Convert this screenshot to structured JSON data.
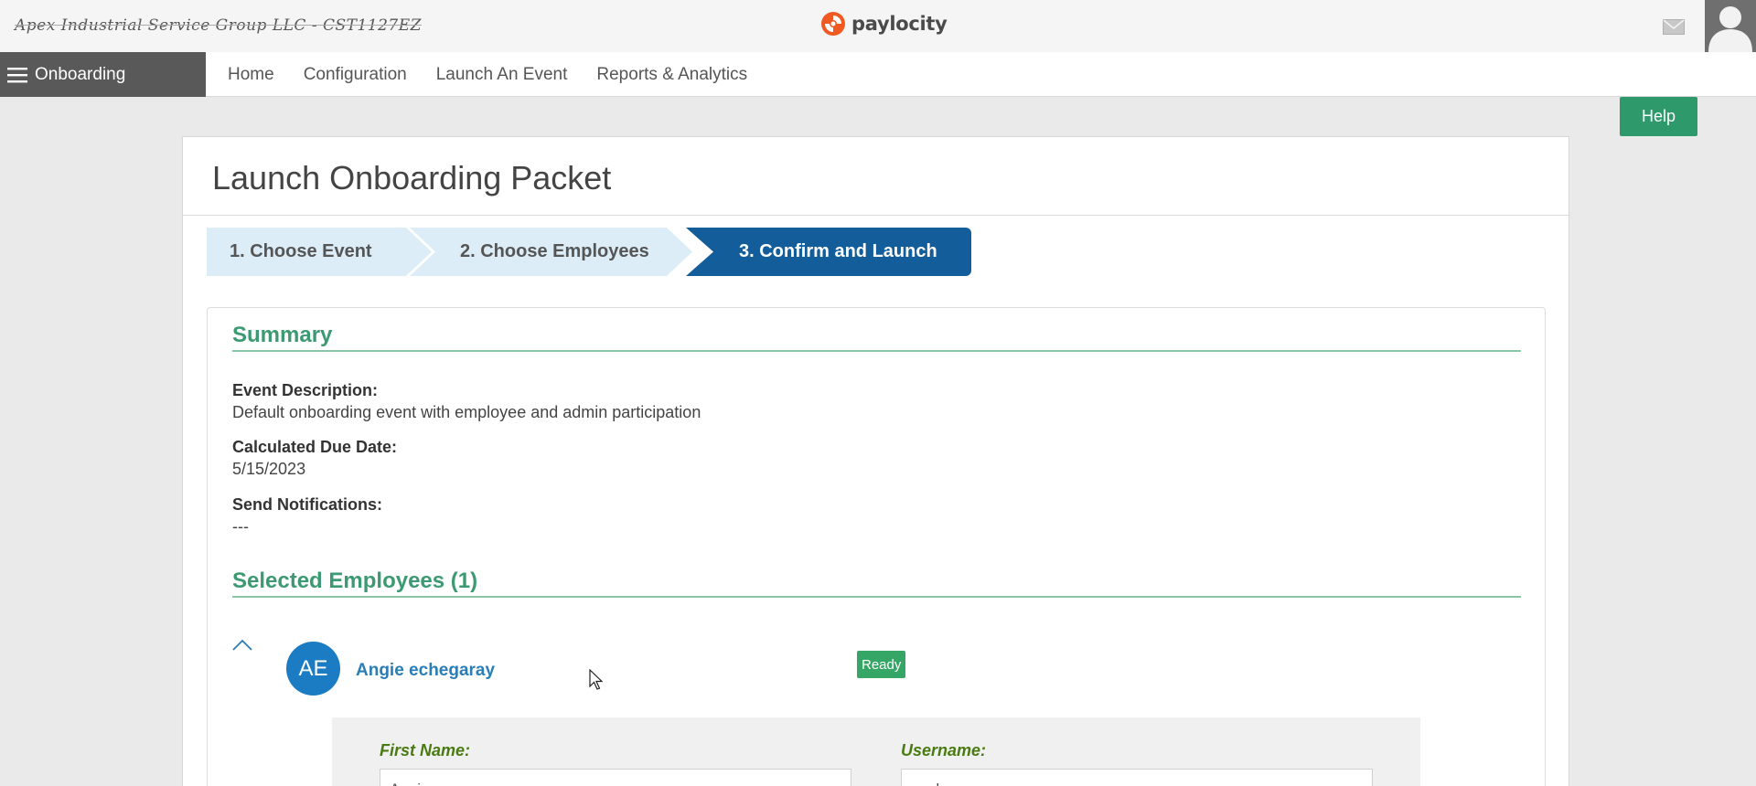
{
  "header": {
    "company_name": "Apex Industrial Service Group LLC - CST1127EZ",
    "brand": "paylocity",
    "icons": {
      "mail": "mail-icon",
      "profile": "user-avatar-icon"
    }
  },
  "nav": {
    "module_label": "Onboarding",
    "links": [
      "Home",
      "Configuration",
      "Launch An Event",
      "Reports & Analytics"
    ]
  },
  "help_label": "Help",
  "page": {
    "title": "Launch Onboarding Packet",
    "steps": [
      "1. Choose Event",
      "2. Choose Employees",
      "3. Confirm and Launch"
    ],
    "active_step": 3
  },
  "summary": {
    "title": "Summary",
    "event_description_label": "Event Description:",
    "event_description": "Default onboarding event with employee and admin participation",
    "due_date_label": "Calculated Due Date:",
    "due_date": "5/15/2023",
    "notifications_label": "Send Notifications:",
    "notifications": "---"
  },
  "employees": {
    "title": "Selected Employees (1)",
    "items": [
      {
        "initials": "AE",
        "name": "Angie echegaray",
        "status": "Ready",
        "first_name_label": "First Name:",
        "first_name": "Angie",
        "username_label": "Username:",
        "username": "aechegaray"
      }
    ]
  },
  "colors": {
    "accent_green": "#3c9a72",
    "help_green": "#2e9a6c",
    "active_step_blue": "#135d9a",
    "inactive_step": "#dcedf8",
    "avatar_blue": "#1c7cc3",
    "link_blue": "#2a7db5",
    "ready_green": "#35a665"
  }
}
